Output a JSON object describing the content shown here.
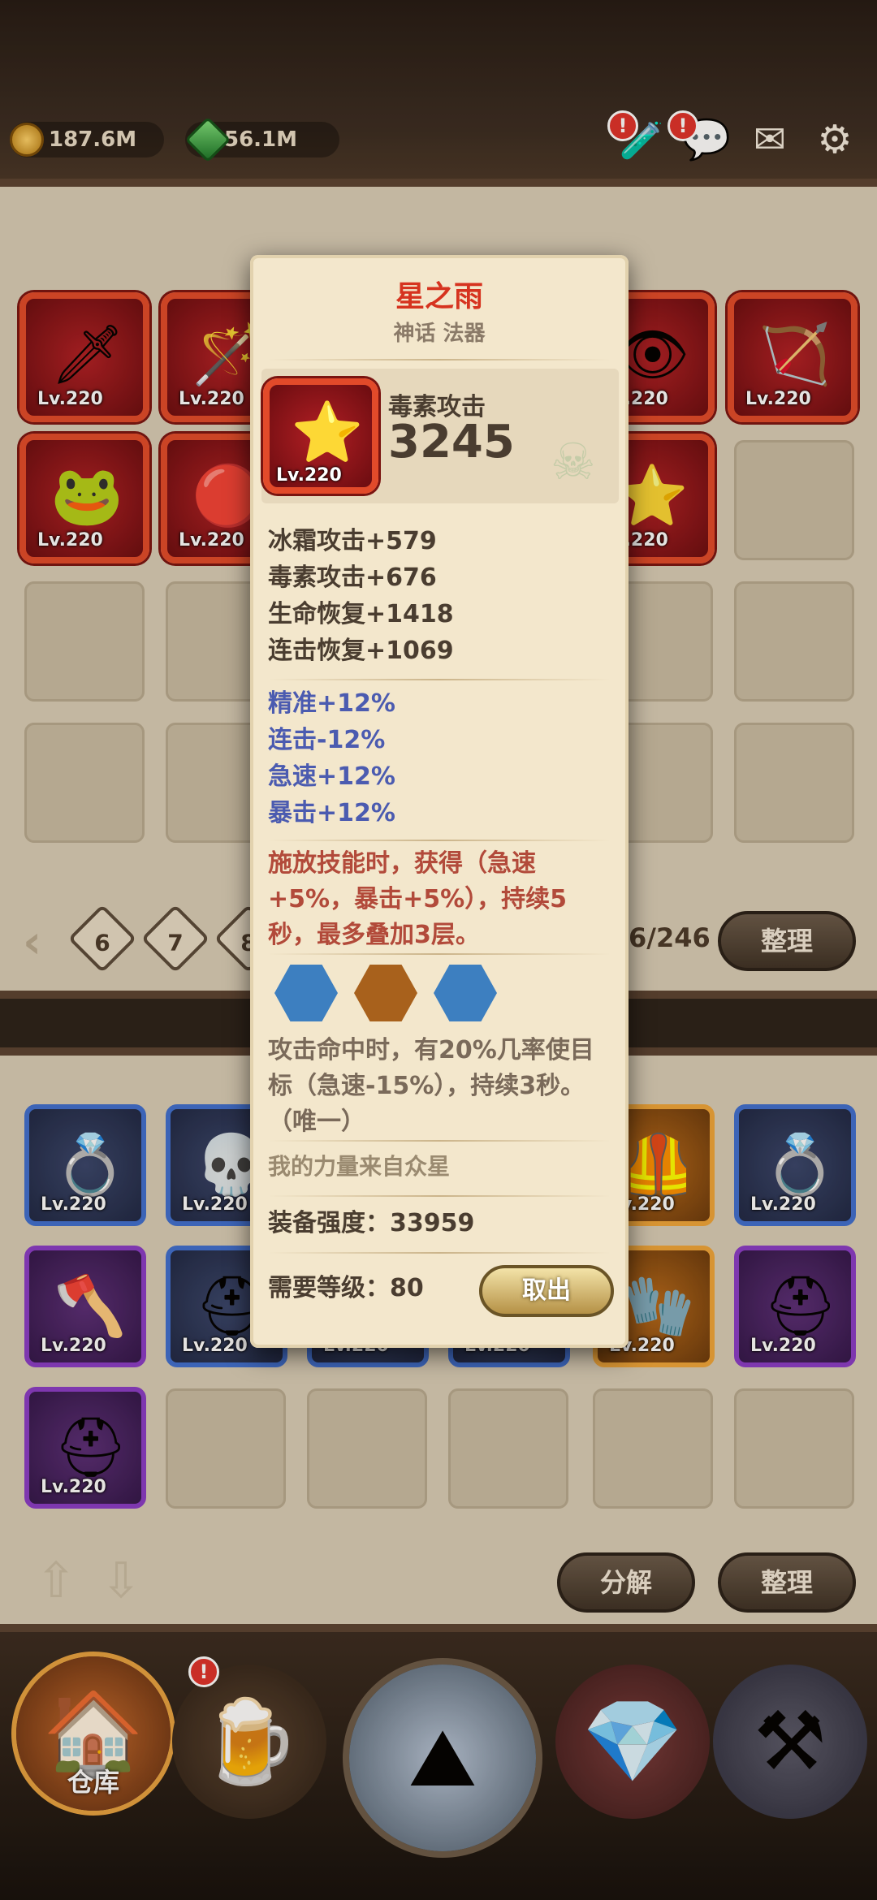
{
  "currency": {
    "gold": "187.6M",
    "gems": "56.1M"
  },
  "top_icons": {
    "badge_text": "!"
  },
  "inventory_top": {
    "levels": [
      "Lv.220",
      "Lv.220",
      "Lv.220",
      "Lv.220",
      "Lv.220",
      "Lv.220",
      "Lv.220",
      "Lv.220",
      "Lv.220"
    ],
    "pagination": {
      "pages": [
        "6",
        "7",
        "8"
      ],
      "counter": "6/246"
    },
    "sort_button": "整理"
  },
  "inventory_bottom": {
    "levels": [
      "Lv.220",
      "Lv.220",
      "Lv.220",
      "Lv.220",
      "Lv.220",
      "Lv.220",
      "Lv.220",
      "Lv.220",
      "Lv.220",
      "Lv.220",
      "Lv.220"
    ],
    "dismantle_button": "分解",
    "sort_button": "整理"
  },
  "bottom_nav": {
    "warehouse_label": "仓库",
    "badge_text": "!"
  },
  "item_popup": {
    "name": "星之雨",
    "rarity": "神话 法器",
    "level": "Lv.220",
    "main_stat_label": "毒素攻击",
    "main_stat_value": "3245",
    "base_stats": [
      "冰霜攻击+579",
      "毒素攻击+676",
      "生命恢复+1418",
      "连击恢复+1069"
    ],
    "bonus_stats": [
      "精准+12%",
      "连击-12%",
      "急速+12%",
      "暴击+12%"
    ],
    "skill_effect": "施放技能时，获得（急速+5%，暴击+5%），持续5秒，最多叠加3层。",
    "sockets": [
      "blue",
      "bronze",
      "blue"
    ],
    "socket_colors": {
      "blue": "#3d7fc0",
      "bronze": "#a8611c"
    },
    "unique_effect": "攻击命中时，有20%几率使目标（急速-15%），持续3秒。（唯一）",
    "flavor_text": "我的力量来自众星",
    "power_label": "装备强度：",
    "power_value": "33959",
    "required_level_label": "需要等级：",
    "required_level_value": "80",
    "take_out_button": "取出"
  },
  "colors": {
    "rarity_red": "#d6331f",
    "accent_blue": "#4b5bb0",
    "effect_red": "#b24a3a"
  }
}
